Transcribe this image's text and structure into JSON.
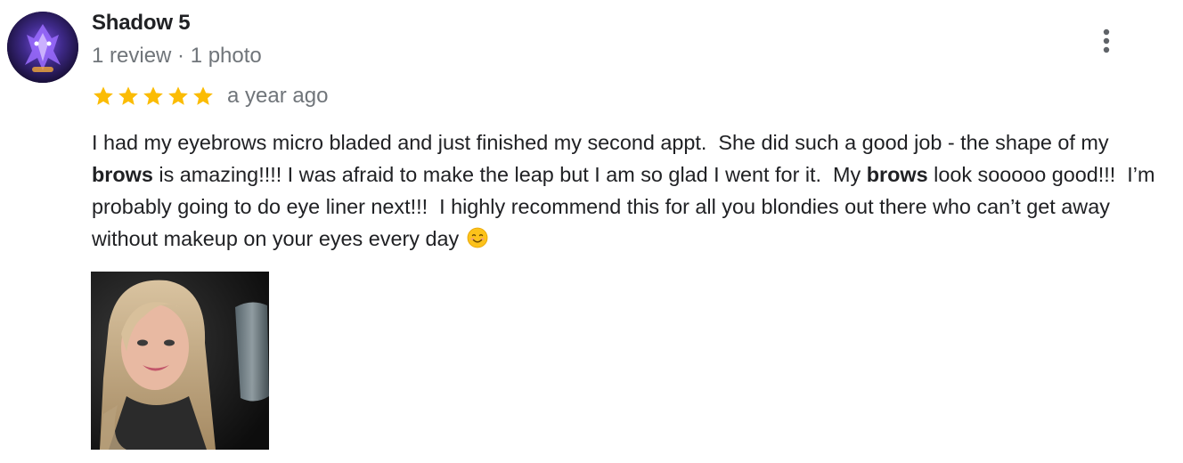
{
  "reviewer": {
    "name": "Shadow 5",
    "meta": "1 review · 1 photo"
  },
  "rating": {
    "stars": 5,
    "max_stars": 5,
    "star_color": "#fbbc04",
    "date": "a year ago"
  },
  "review": {
    "segments": [
      {
        "text": "I had my eyebrows micro bladed and just finished my second appt.  She did such a good job - the shape of my ",
        "bold": false
      },
      {
        "text": "brows",
        "bold": true
      },
      {
        "text": " is amazing!!!! I was afraid to make the leap but I am so glad I went for it.  My ",
        "bold": false
      },
      {
        "text": "brows",
        "bold": true
      },
      {
        "text": " look sooooo good!!!  I’m probably going to do eye liner next!!!  I highly recommend this for all you blondies out there who can’t get away without makeup on your eyes every day ",
        "bold": false
      }
    ],
    "emoji": "smiling-face-icon"
  },
  "icons": {
    "more": "more-vertical-icon",
    "star": "star-icon",
    "avatar": "avatar-image",
    "photo": "review-photo"
  },
  "colors": {
    "name": "#202124",
    "meta": "#70757a",
    "text": "#202124"
  }
}
